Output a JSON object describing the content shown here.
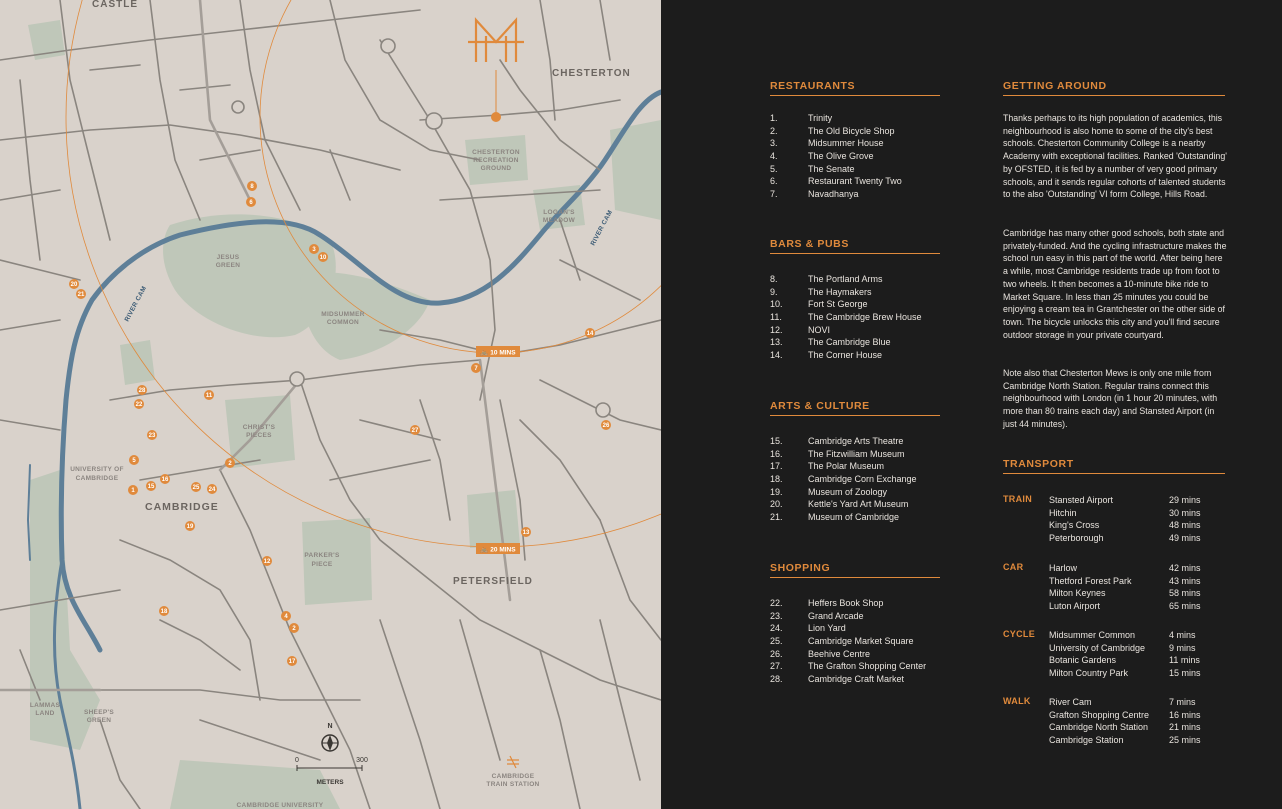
{
  "map": {
    "place_labels": {
      "castle": "CASTLE",
      "chesterton": "CHESTERTON",
      "cambridge": "CAMBRIDGE",
      "petersfield": "PETERSFIELD"
    },
    "area_labels": {
      "chesterton_rec_1": "CHESTERTON",
      "chesterton_rec_2": "RECREATION",
      "chesterton_rec_3": "GROUND",
      "logans_1": "LOGAN'S",
      "logans_2": "MEADOW",
      "jesus_1": "JESUS",
      "jesus_2": "GREEN",
      "midsummer_1": "MIDSUMMER",
      "midsummer_2": "COMMON",
      "christs_1": "CHRIST'S",
      "christs_2": "PIECES",
      "uni_1": "UNIVERSITY OF",
      "uni_2": "CAMBRIDGE",
      "parkers_1": "PARKER'S",
      "parkers_2": "PIECE",
      "lammas_1": "LAMMAS",
      "lammas_2": "LAND",
      "sheeps_1": "SHEEP'S",
      "sheeps_2": "GREEN",
      "station_1": "CAMBRIDGE",
      "station_2": "TRAIN STATION",
      "cam_uni_bottom": "CAMBRIDGE UNIVERSITY"
    },
    "river_labels": {
      "river_cam_1": "RIVER CAM",
      "river_cam_2": "RIVER CAM"
    },
    "radius_labels": {
      "ten": "10 MINS",
      "twenty": "20 MINS"
    },
    "scale": {
      "zero": "0",
      "max": "300",
      "unit": "METERS"
    },
    "compass": "N",
    "pins": [
      "8",
      "6",
      "3",
      "10",
      "20",
      "21",
      "14",
      "7",
      "26",
      "11",
      "28",
      "22",
      "27",
      "23",
      "5",
      "15",
      "16",
      "1",
      "25",
      "24",
      "2",
      "19",
      "12",
      "18",
      "13",
      "4",
      "2",
      "17"
    ],
    "colors": {
      "land": "#d9d2cb",
      "road": "#8a857f",
      "park": "#bfc7b9",
      "river": "#5e7f98",
      "accent": "#e08a3c"
    }
  },
  "restaurants": {
    "title": "RESTAURANTS",
    "items": [
      {
        "num": "1.",
        "name": "Trinity"
      },
      {
        "num": "2.",
        "name": "The Old Bicycle Shop"
      },
      {
        "num": "3.",
        "name": "Midsummer House"
      },
      {
        "num": "4.",
        "name": "The Olive Grove"
      },
      {
        "num": "5.",
        "name": "The Senate"
      },
      {
        "num": "6.",
        "name": "Restaurant Twenty Two"
      },
      {
        "num": "7.",
        "name": "Navadhanya"
      }
    ]
  },
  "bars": {
    "title": "BARS & PUBS",
    "items": [
      {
        "num": "8.",
        "name": "The Portland Arms"
      },
      {
        "num": "9.",
        "name": "The Haymakers"
      },
      {
        "num": "10.",
        "name": "Fort St George"
      },
      {
        "num": "11.",
        "name": "The Cambridge Brew House"
      },
      {
        "num": "12.",
        "name": "NOVI"
      },
      {
        "num": "13.",
        "name": "The Cambridge Blue"
      },
      {
        "num": "14.",
        "name": "The Corner House"
      }
    ]
  },
  "arts": {
    "title": "ARTS & CULTURE",
    "items": [
      {
        "num": "15.",
        "name": "Cambridge Arts Theatre"
      },
      {
        "num": "16.",
        "name": "The Fitzwilliam Museum"
      },
      {
        "num": "17.",
        "name": "The Polar Museum"
      },
      {
        "num": "18.",
        "name": "Cambridge Corn Exchange"
      },
      {
        "num": "19.",
        "name": "Museum of Zoology"
      },
      {
        "num": "20.",
        "name": "Kettle's Yard Art Museum"
      },
      {
        "num": "21.",
        "name": "Museum of Cambridge"
      }
    ]
  },
  "shopping": {
    "title": "SHOPPING",
    "items": [
      {
        "num": "22.",
        "name": "Heffers Book Shop"
      },
      {
        "num": "23.",
        "name": "Grand Arcade"
      },
      {
        "num": "24.",
        "name": "Lion Yard"
      },
      {
        "num": "25.",
        "name": "Cambridge Market Square"
      },
      {
        "num": "26.",
        "name": "Beehive Centre"
      },
      {
        "num": "27.",
        "name": "The Grafton Shopping Center"
      },
      {
        "num": "28.",
        "name": "Cambridge Craft Market"
      }
    ]
  },
  "getting_around": {
    "title": "GETTING AROUND",
    "paragraphs": [
      "Thanks perhaps to its high population of academics, this neighbourhood is also home to some of the city's best schools. Chesterton Community College is a nearby Academy with exceptional facilities. Ranked 'Outstanding' by OFSTED, it is fed by a number of very good primary schools, and it sends regular cohorts of talented students to the also 'Outstanding' VI form College, Hills Road.",
      "Cambridge has many other good schools, both state and privately-funded. And the cycling infrastructure makes the school run easy in this part of the world. After being here a while, most Cambridge residents trade up from foot to two wheels. It then becomes a 10-minute bike ride to Market Square. In less than 25 minutes you could be enjoying a cream tea in Grantchester on the other side of town. The bicycle unlocks this city and you'll find secure outdoor storage in your private courtyard.",
      "Note also that Chesterton Mews is only one mile from Cambridge North Station. Regular trains connect this neighbourhood with London (in 1 hour 20 minutes, with more than 80 trains each day) and Stansted Airport (in just 44 minutes)."
    ]
  },
  "transport": {
    "title": "TRANSPORT",
    "groups": [
      {
        "mode": "TRAIN",
        "rows": [
          {
            "dest": "Stansted Airport",
            "time": "29 mins"
          },
          {
            "dest": "Hitchin",
            "time": "30 mins"
          },
          {
            "dest": "King's Cross",
            "time": "48 mins"
          },
          {
            "dest": "Peterborough",
            "time": "49 mins"
          }
        ]
      },
      {
        "mode": "CAR",
        "rows": [
          {
            "dest": "Harlow",
            "time": "42 mins"
          },
          {
            "dest": "Thetford Forest Park",
            "time": "43 mins"
          },
          {
            "dest": "Milton Keynes",
            "time": "58 mins"
          },
          {
            "dest": "Luton Airport",
            "time": "65 mins"
          }
        ]
      },
      {
        "mode": "CYCLE",
        "rows": [
          {
            "dest": "Midsummer Common",
            "time": "4 mins"
          },
          {
            "dest": "University of Cambridge",
            "time": "9 mins"
          },
          {
            "dest": "Botanic Gardens",
            "time": "11 mins"
          },
          {
            "dest": "Milton Country Park",
            "time": "15 mins"
          }
        ]
      },
      {
        "mode": "WALK",
        "rows": [
          {
            "dest": "River Cam",
            "time": "7 mins"
          },
          {
            "dest": "Grafton Shopping Centre",
            "time": "16 mins"
          },
          {
            "dest": "Cambridge North Station",
            "time": "21 mins"
          },
          {
            "dest": "Cambridge Station",
            "time": "25 mins"
          }
        ]
      }
    ]
  }
}
